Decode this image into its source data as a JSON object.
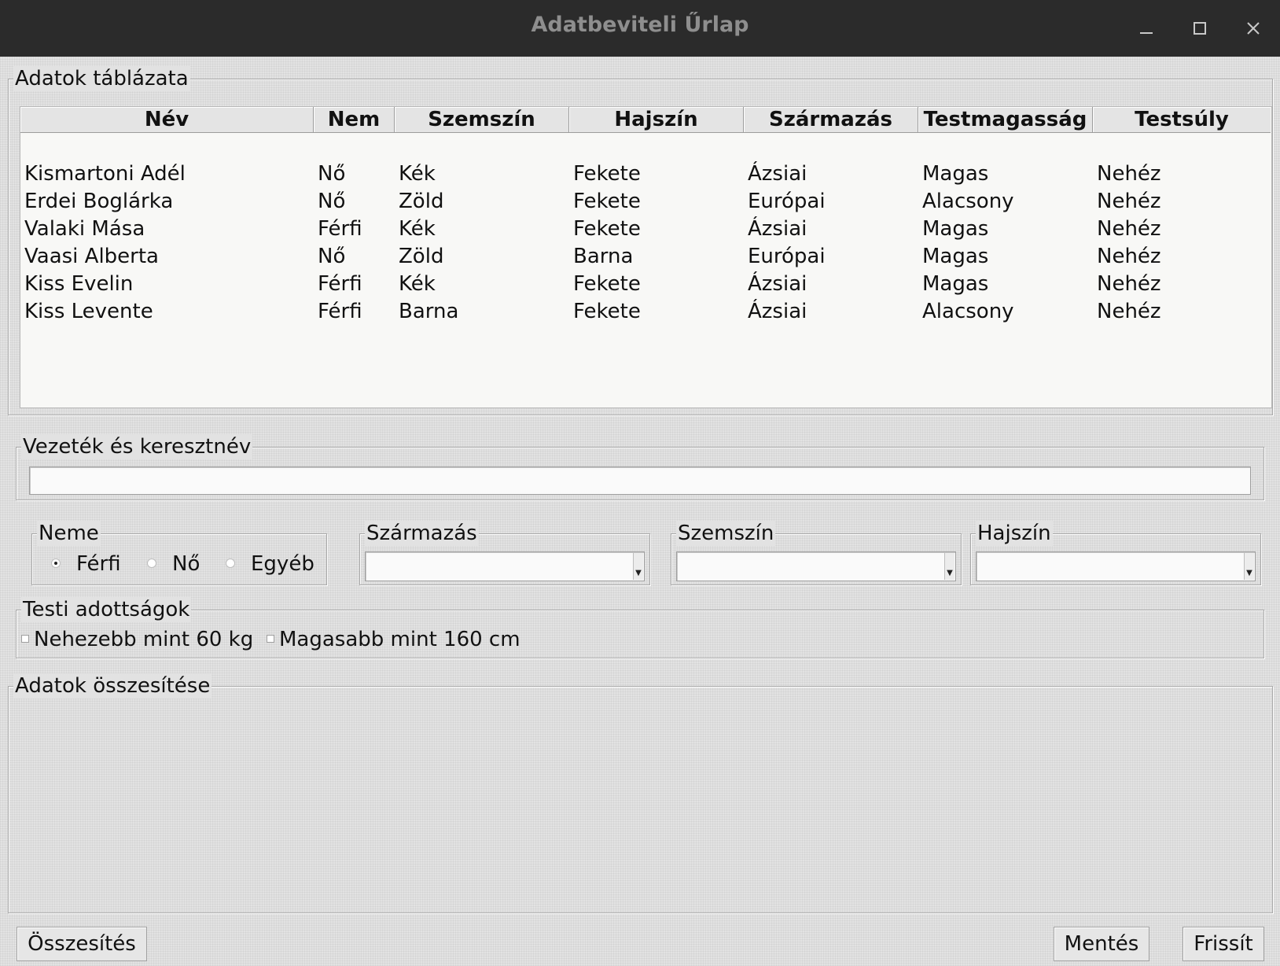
{
  "window": {
    "title": "Adatbeviteli Űrlap"
  },
  "table_section": {
    "legend": "Adatok táblázata",
    "columns": [
      "Név",
      "Nem",
      "Szemszín",
      "Hajszín",
      "Származás",
      "Testmagasság",
      "Testsúly"
    ],
    "rows": [
      [
        "Kismartoni Adél",
        "Nő",
        "Kék",
        "Fekete",
        "Ázsiai",
        "Magas",
        "Nehéz"
      ],
      [
        "Erdei Boglárka",
        "Nő",
        "Zöld",
        "Fekete",
        "Európai",
        "Alacsony",
        "Nehéz"
      ],
      [
        "Valaki Mása",
        "Férfi",
        "Kék",
        "Fekete",
        "Ázsiai",
        "Magas",
        "Nehéz"
      ],
      [
        "Vaasi Alberta",
        "Nő",
        "Zöld",
        "Barna",
        "Európai",
        "Magas",
        "Nehéz"
      ],
      [
        "Kiss Evelin",
        "Férfi",
        "Kék",
        "Fekete",
        "Ázsiai",
        "Magas",
        "Nehéz"
      ],
      [
        "Kiss Levente",
        "Férfi",
        "Barna",
        "Fekete",
        "Ázsiai",
        "Alacsony",
        "Nehéz"
      ]
    ]
  },
  "name_section": {
    "legend": "Vezeték és keresztnév",
    "value": ""
  },
  "gender_section": {
    "legend": "Neme",
    "options": [
      "Férfi",
      "Nő",
      "Egyéb"
    ],
    "selected": "Férfi"
  },
  "origin_section": {
    "legend": "Származás",
    "value": ""
  },
  "eye_section": {
    "legend": "Szemszín",
    "value": ""
  },
  "hair_section": {
    "legend": "Hajszín",
    "value": ""
  },
  "body_section": {
    "legend": "Testi adottságok",
    "checkboxes": [
      {
        "label": "Nehezebb mint 60 kg",
        "checked": false
      },
      {
        "label": "Magasabb mint 160 cm",
        "checked": false
      }
    ]
  },
  "summary_section": {
    "legend": "Adatok összesítése",
    "text": ""
  },
  "buttons": {
    "summarize": "Összesítés",
    "save": "Mentés",
    "refresh": "Frissít"
  }
}
